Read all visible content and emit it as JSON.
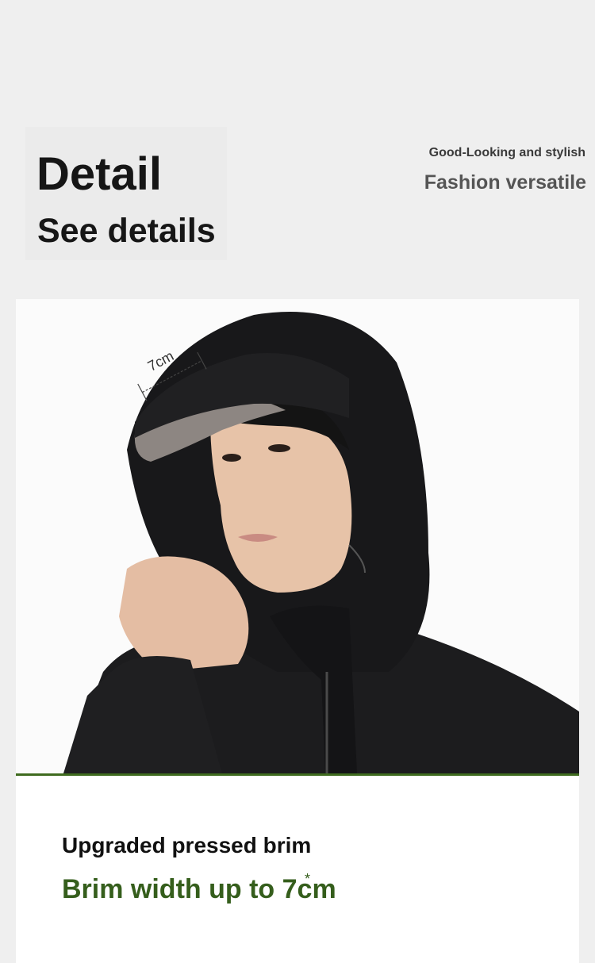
{
  "header": {
    "title": "Detail",
    "subtitle": "See details"
  },
  "tagline": {
    "small": "Good-Looking and stylish",
    "big": "Fashion versatile"
  },
  "photo": {
    "measure_label": "7cm"
  },
  "caption": {
    "line1": "Upgraded pressed brim",
    "line2": "Brim width up to 7cm"
  },
  "colors": {
    "accent_green": "#355e1c",
    "divider_green": "#3f6b1f",
    "jacket": "#1c1c1e"
  }
}
